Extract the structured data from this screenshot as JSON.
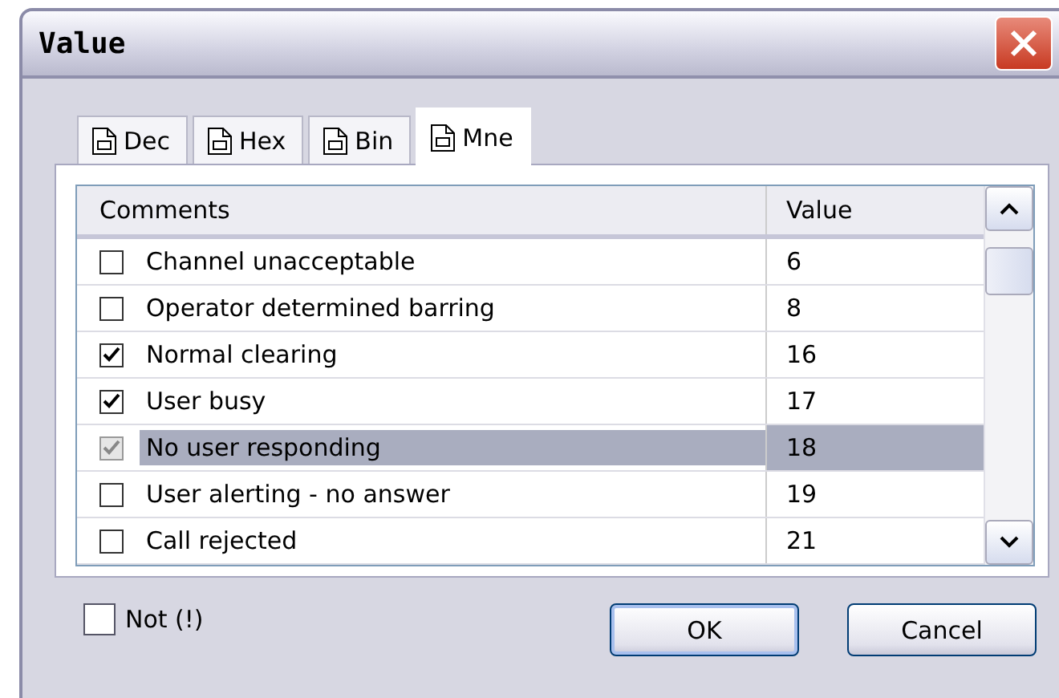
{
  "window": {
    "title": "Value"
  },
  "tabs": [
    {
      "label": "Dec",
      "selected": false
    },
    {
      "label": "Hex",
      "selected": false
    },
    {
      "label": "Bin",
      "selected": false
    },
    {
      "label": "Mne",
      "selected": true
    }
  ],
  "table": {
    "columns": [
      "Comments",
      "Value"
    ],
    "rows": [
      {
        "comment": "Channel unacceptable",
        "value": "6",
        "checked": false,
        "selected": false
      },
      {
        "comment": "Operator determined barring",
        "value": "8",
        "checked": false,
        "selected": false
      },
      {
        "comment": "Normal clearing",
        "value": "16",
        "checked": true,
        "selected": false
      },
      {
        "comment": "User busy",
        "value": "17",
        "checked": true,
        "selected": false
      },
      {
        "comment": "No user responding",
        "value": "18",
        "checked": true,
        "selected": true
      },
      {
        "comment": "User alerting - no answer",
        "value": "19",
        "checked": false,
        "selected": false
      },
      {
        "comment": "Call rejected",
        "value": "21",
        "checked": false,
        "selected": false
      }
    ]
  },
  "not_checkbox": {
    "label": "Not (!)",
    "checked": false
  },
  "buttons": [
    "OK",
    "Cancel"
  ]
}
